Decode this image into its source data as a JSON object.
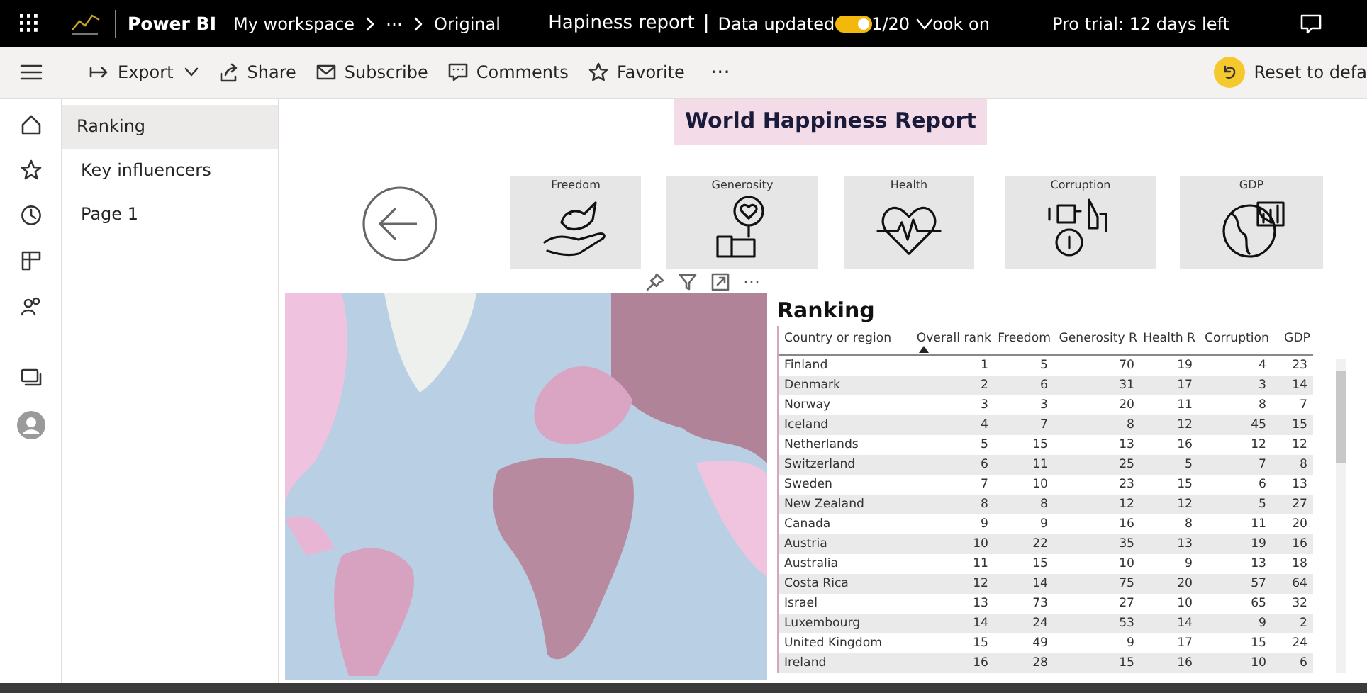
{
  "top_bar": {
    "app_name": "Power BI",
    "breadcrumb": [
      "My workspace",
      "⋯",
      "Original"
    ],
    "report_title": "Hapiness report",
    "separator": "|",
    "data_updated": "Data updated",
    "toggle": {
      "on": true
    },
    "date_fragment": "1/20",
    "view_fragment": "ook on",
    "trial": "Pro trial: 12 days left"
  },
  "toolbar": {
    "items": [
      {
        "kind": "export",
        "label": "Export"
      },
      {
        "kind": "share",
        "label": "Share"
      },
      {
        "kind": "subscribe",
        "label": "Subscribe"
      },
      {
        "kind": "comments",
        "label": "Comments"
      },
      {
        "kind": "favorite",
        "label": "Favorite"
      }
    ],
    "more": "⋯",
    "reset": "Reset to defa"
  },
  "pages": [
    {
      "label": "Ranking",
      "selected": true
    },
    {
      "label": "Key influencers",
      "selected": false
    },
    {
      "label": "Page 1",
      "selected": false
    }
  ],
  "report": {
    "title": "World Happiness Report",
    "tiles": [
      {
        "kind": "freedom",
        "label": "Freedom"
      },
      {
        "kind": "generosity",
        "label": "Generosity"
      },
      {
        "kind": "health",
        "label": "Health"
      },
      {
        "kind": "corruption",
        "label": "Corruption"
      },
      {
        "kind": "gdp",
        "label": "GDP"
      }
    ],
    "visual_header_more": "⋯",
    "table": {
      "title": "Ranking",
      "columns": [
        {
          "label": "Country or region",
          "sorted": false
        },
        {
          "label": "Overall rank",
          "sorted": true
        },
        {
          "label": "Freedom",
          "sorted": false
        },
        {
          "label": "Generosity R",
          "sorted": false
        },
        {
          "label": "Health R",
          "sorted": false
        },
        {
          "label": "Corruption",
          "sorted": false
        },
        {
          "label": "GDP",
          "sorted": false
        }
      ],
      "rows": [
        [
          "Finland",
          "1",
          "5",
          "70",
          "19",
          "4",
          "23"
        ],
        [
          "Denmark",
          "2",
          "6",
          "31",
          "17",
          "3",
          "14"
        ],
        [
          "Norway",
          "3",
          "3",
          "20",
          "11",
          "8",
          "7"
        ],
        [
          "Iceland",
          "4",
          "7",
          "8",
          "12",
          "45",
          "15"
        ],
        [
          "Netherlands",
          "5",
          "15",
          "13",
          "16",
          "12",
          "12"
        ],
        [
          "Switzerland",
          "6",
          "11",
          "25",
          "5",
          "7",
          "8"
        ],
        [
          "Sweden",
          "7",
          "10",
          "23",
          "15",
          "6",
          "13"
        ],
        [
          "New Zealand",
          "8",
          "8",
          "12",
          "12",
          "5",
          "27"
        ],
        [
          "Canada",
          "9",
          "9",
          "16",
          "8",
          "11",
          "20"
        ],
        [
          "Austria",
          "10",
          "22",
          "35",
          "13",
          "19",
          "16"
        ],
        [
          "Australia",
          "11",
          "15",
          "10",
          "9",
          "13",
          "18"
        ],
        [
          "Costa Rica",
          "12",
          "14",
          "75",
          "20",
          "57",
          "64"
        ],
        [
          "Israel",
          "13",
          "73",
          "27",
          "10",
          "65",
          "32"
        ],
        [
          "Luxembourg",
          "14",
          "24",
          "53",
          "14",
          "9",
          "2"
        ],
        [
          "United Kingdom",
          "15",
          "49",
          "9",
          "17",
          "15",
          "24"
        ],
        [
          "Ireland",
          "16",
          "28",
          "15",
          "16",
          "10",
          "6"
        ]
      ]
    }
  }
}
